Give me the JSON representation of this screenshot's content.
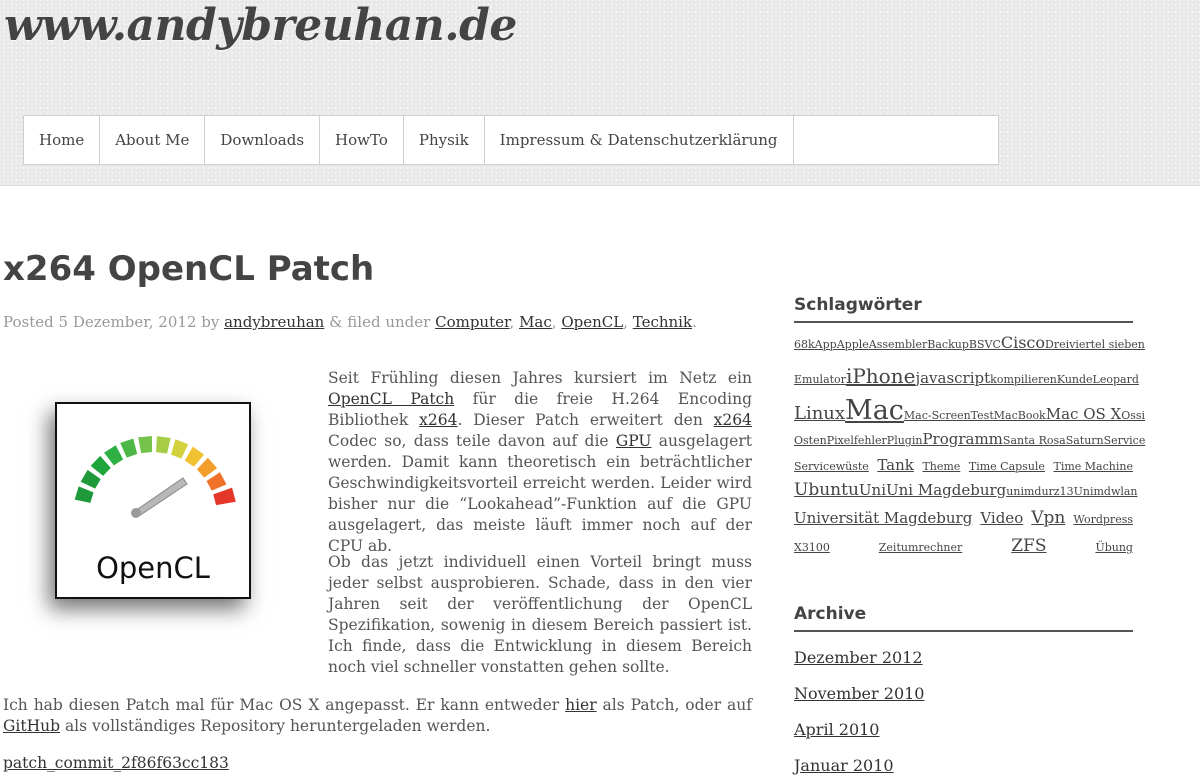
{
  "site": {
    "title": "www.andybreuhan.de"
  },
  "nav": {
    "items": [
      "Home",
      "About Me",
      "Downloads",
      "HowTo",
      "Physik",
      "Impressum & Datenschutzerklärung"
    ]
  },
  "post": {
    "title": "x264 OpenCL Patch",
    "meta": {
      "posted": "Posted",
      "date": "5 Dezember, 2012",
      "by": "by",
      "author": "andybreuhan",
      "amp": "&",
      "filed": "filed under",
      "categories": [
        "Computer",
        "Mac",
        "OpenCL",
        "Technik"
      ]
    },
    "image": {
      "label": "OpenCL",
      "icon": "opencl-gauge-logo"
    },
    "p1": {
      "t1": "Seit Frühling diesen Jahres kursiert im Netz ein",
      "l1": "OpenCL Patch",
      "t2": "für die freie H.264 Encoding Bibliothek",
      "l2": "x264",
      "t3": ". Dieser Patch erweitert den",
      "l3": "x264",
      "t4": "Codec so, dass teile davon auf die",
      "l4": "GPU",
      "t5": "ausgelagert werden. Damit kann theoretisch ein beträchtlicher Geschwindigkeitsvorteil erreicht werden. Leider wird bisher nur die “Lookahead”-Funktion auf die GPU ausgelagert, das meiste läuft immer noch auf der CPU ab."
    },
    "p2": "Ob das jetzt individuell einen Vorteil bringt muss jeder selbst ausprobieren. Schade, dass in den vier Jahren seit der veröffentlichung der OpenCL Spezifikation, sowenig in diesem Bereich passiert ist.  Ich finde, dass die Entwicklung in diesem Bereich noch viel schneller vonstatten gehen sollte.",
    "p3": {
      "t1": "Ich hab diesen Patch mal für Mac OS X angepasst. Er kann entweder",
      "l1": "hier",
      "t2": "als Patch, oder auf",
      "l2": "GitHub",
      "t3": "als vollständiges Repository heruntergeladen werden."
    },
    "download_link": "patch_commit_2f86f63cc183"
  },
  "sidebar": {
    "tags_title": "Schlagwörter",
    "tags": [
      [
        {
          "text": "68k",
          "size": 11
        },
        {
          "text": "App",
          "size": 11
        },
        {
          "text": "Apple",
          "size": 11
        },
        {
          "text": "Assembler",
          "size": 11
        },
        {
          "text": "Backup",
          "size": 11
        },
        {
          "text": "BSVC",
          "size": 11
        },
        {
          "text": "Cisco",
          "size": 16
        },
        {
          "text": "Dreiviertel sieben",
          "size": 11
        }
      ],
      [
        {
          "text": "Emulator",
          "size": 11
        },
        {
          "text": "iPhone",
          "size": 20
        },
        {
          "text": "javascript",
          "size": 15
        },
        {
          "text": "kompilieren",
          "size": 11
        },
        {
          "text": "Kunde",
          "size": 11
        },
        {
          "text": "Leopard",
          "size": 11
        }
      ],
      [
        {
          "text": "Linux",
          "size": 18
        },
        {
          "text": "Mac",
          "size": 27
        },
        {
          "text": "Mac-ScreenTest",
          "size": 11
        },
        {
          "text": "MacBook",
          "size": 11
        },
        {
          "text": "Mac OS X",
          "size": 15
        },
        {
          "text": "Ossi",
          "size": 11
        }
      ],
      [
        {
          "text": "Osten",
          "size": 11
        },
        {
          "text": "Pixelfehler",
          "size": 11
        },
        {
          "text": "Plugin",
          "size": 11
        },
        {
          "text": "Programm",
          "size": 15
        },
        {
          "text": "Santa Rosa",
          "size": 11
        },
        {
          "text": "Saturn",
          "size": 11
        },
        {
          "text": "Service",
          "size": 11
        }
      ],
      [
        {
          "text": "Servicewüste",
          "size": 11
        },
        {
          "text": "Tank",
          "size": 15
        },
        {
          "text": "Theme",
          "size": 11
        },
        {
          "text": "Time Capsule",
          "size": 11
        },
        {
          "text": "Time Machine",
          "size": 11
        }
      ],
      [
        {
          "text": "Ubuntu",
          "size": 17
        },
        {
          "text": "Uni",
          "size": 15
        },
        {
          "text": "Uni Magdeburg",
          "size": 15
        },
        {
          "text": "unimdurz13",
          "size": 11
        },
        {
          "text": "Unimdwlan",
          "size": 11
        }
      ],
      [
        {
          "text": "Universität Magdeburg",
          "size": 15
        },
        {
          "text": "Video",
          "size": 15
        },
        {
          "text": "Vpn",
          "size": 17
        },
        {
          "text": "Wordpress",
          "size": 11
        }
      ],
      [
        {
          "text": "X3100",
          "size": 11
        },
        {
          "text": "Zeitumrechner",
          "size": 11
        },
        {
          "text": "ZFS",
          "size": 17
        },
        {
          "text": "Übung",
          "size": 11
        }
      ]
    ],
    "archive_title": "Archive",
    "archive": [
      "Dezember 2012",
      "November 2010",
      "April 2010",
      "Januar 2010"
    ]
  }
}
